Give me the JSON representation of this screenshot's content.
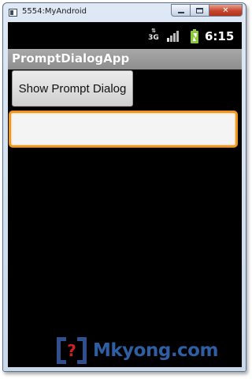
{
  "window": {
    "title": "5554:MyAndroid",
    "close_glyph": "✕"
  },
  "statusbar": {
    "network_arrows": "⇅",
    "network_type": "3G",
    "signal_bars": 4,
    "signal_active_bars": 1,
    "battery_state": "charging",
    "battery_color": "#8dc63f",
    "time": "6:15"
  },
  "app": {
    "title": "PromptDialogApp",
    "prompt_button_label": "Show Prompt Dialog",
    "input_value": "",
    "input_focus_color": "#f0951e"
  },
  "watermark": {
    "logo_glyph": "?",
    "text": "Mkyong.com",
    "text_color": "#2f5fa3"
  }
}
